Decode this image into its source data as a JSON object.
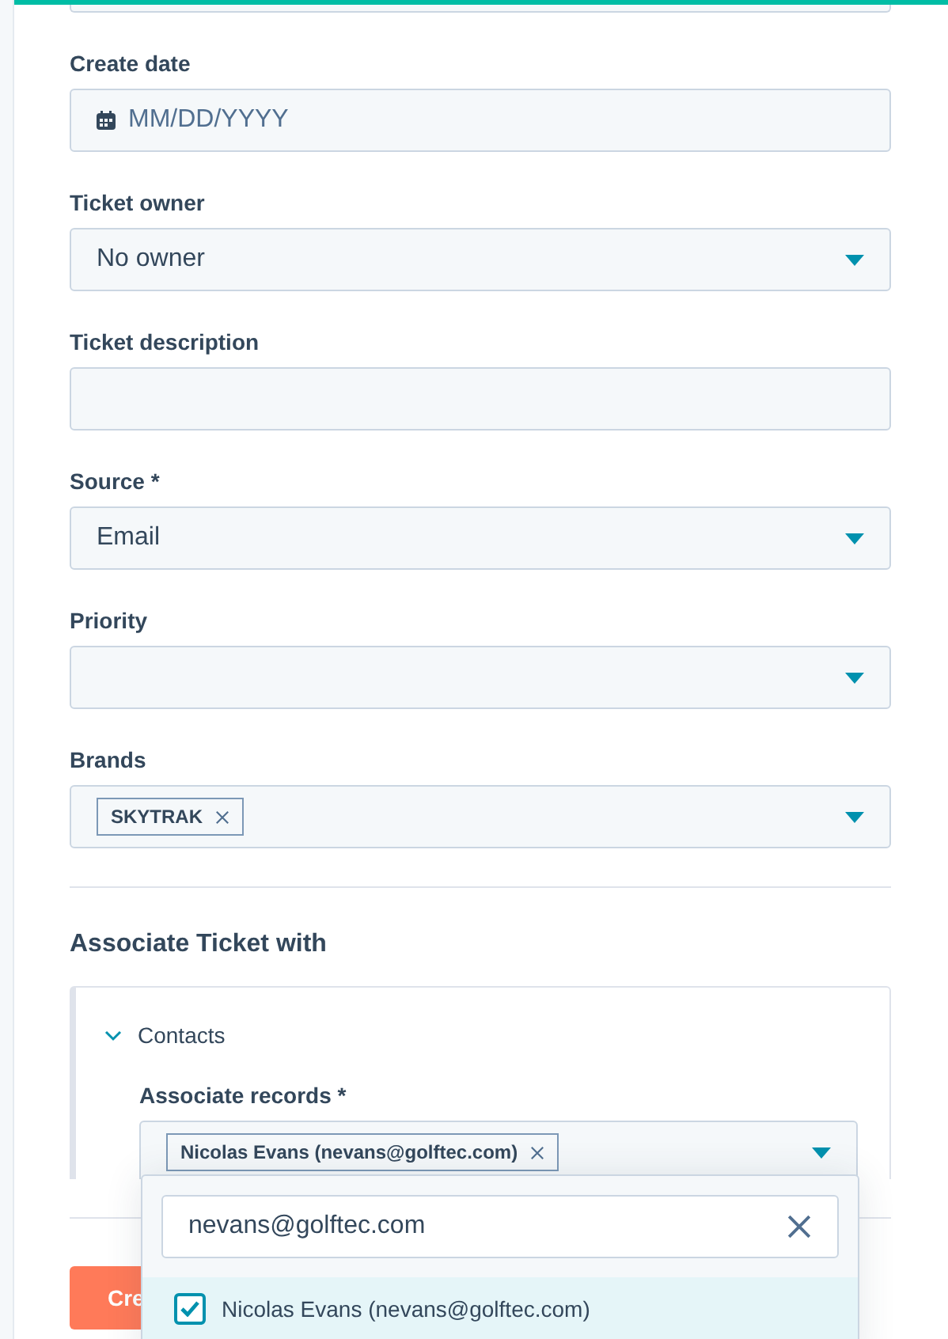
{
  "fields": [
    {
      "kind": "date",
      "label": "Create date",
      "placeholder": "MM/DD/YYYY"
    },
    {
      "kind": "select",
      "label": "Ticket owner",
      "value": "No owner"
    },
    {
      "kind": "text",
      "label": "Ticket description"
    },
    {
      "kind": "select",
      "label": "Source *",
      "value": "Email"
    },
    {
      "kind": "select",
      "label": "Priority"
    },
    {
      "kind": "tags",
      "label": "Brands",
      "tags": [
        "SKYTRAK"
      ]
    }
  ],
  "associate": {
    "title": "Associate Ticket with",
    "section": {
      "label": "Contacts",
      "expanded": true,
      "field_label": "Associate records *",
      "tags": [
        "Nicolas Evans (nevans@golftec.com)"
      ]
    }
  },
  "dropdown": {
    "search_value": "nevans@golftec.com",
    "options": [
      {
        "label": "Nicolas Evans (nevans@golftec.com)",
        "checked": true
      }
    ]
  },
  "primary_button": "Cre"
}
